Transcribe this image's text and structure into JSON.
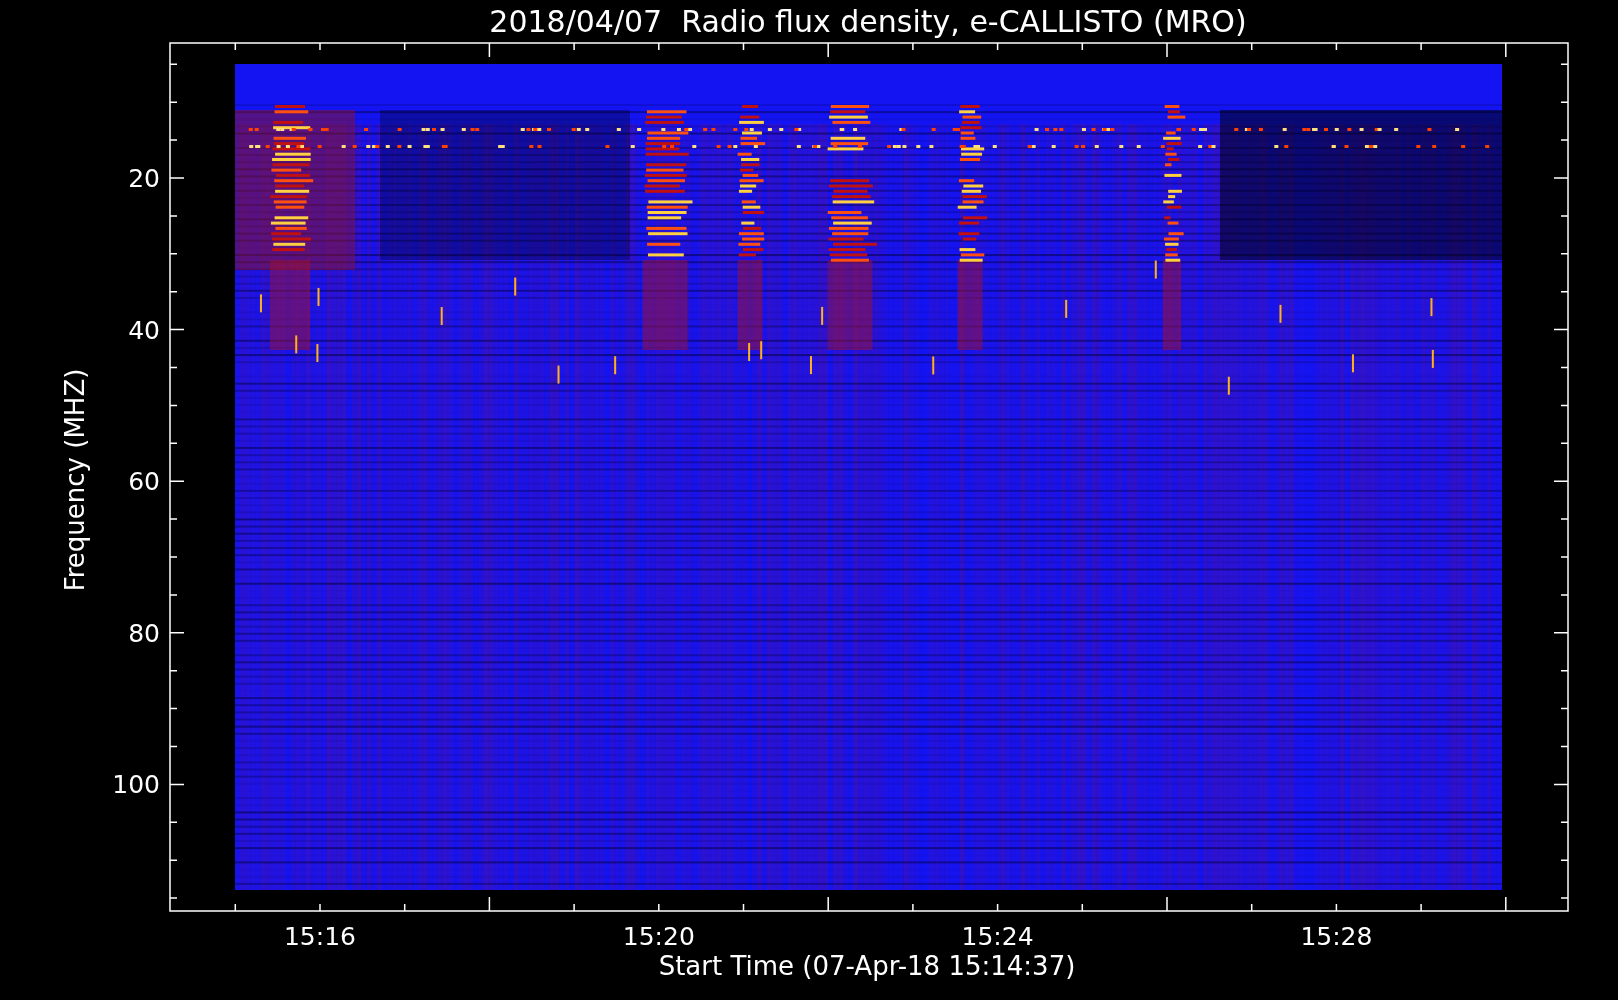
{
  "title": "2018/04/07  Radio flux density, e-CALLISTO (MRO)",
  "x_axis": {
    "label": "Start Time (07-Apr-18 15:14:37)",
    "ticks": [
      "15:16",
      "15:20",
      "15:24",
      "15:28"
    ]
  },
  "y_axis": {
    "label": "Frequency (MHZ)",
    "ticks": [
      "20",
      "40",
      "60",
      "80",
      "100"
    ]
  }
}
